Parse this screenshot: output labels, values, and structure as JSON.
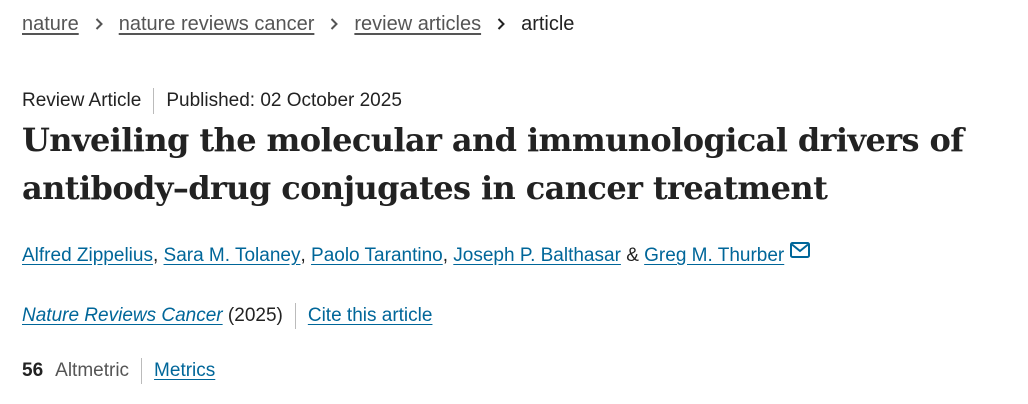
{
  "breadcrumb": {
    "items": [
      {
        "label": "nature"
      },
      {
        "label": "nature reviews cancer"
      },
      {
        "label": "review articles"
      }
    ],
    "current": "article"
  },
  "meta": {
    "article_type": "Review Article",
    "published": "Published: 02 October 2025"
  },
  "title": {
    "line1": "Unveiling the molecular and immunological drivers of",
    "line2": "antibody–drug conjugates in cancer treatment"
  },
  "authors": {
    "list": [
      "Alfred Zippelius",
      "Sara M. Tolaney",
      "Paolo Tarantino",
      "Joseph P. Balthasar",
      "Greg M. Thurber"
    ],
    "comma": ",",
    "ampersand": "&",
    "contact_icon": "envelope-icon"
  },
  "journal": {
    "name": "Nature Reviews Cancer",
    "year": "(2025)",
    "cite_label": "Cite this article"
  },
  "metrics": {
    "altmetric_score": "56",
    "altmetric_label": "Altmetric",
    "metrics_link": "Metrics"
  },
  "colors": {
    "link": "#006699",
    "text": "#222222",
    "muted": "#555555",
    "divider": "#bbbbbb"
  }
}
